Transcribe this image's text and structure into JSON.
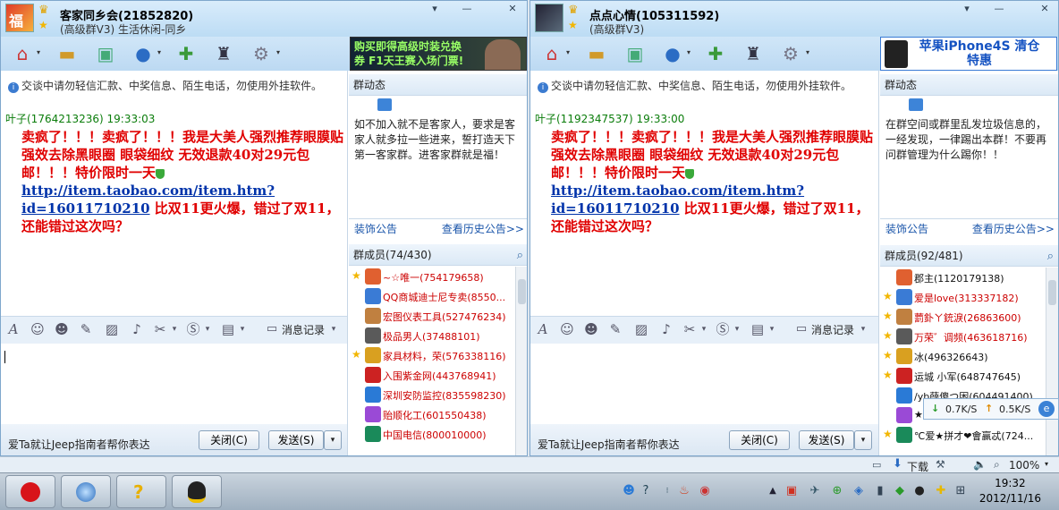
{
  "left_window": {
    "title": "客家同乡会(21852820)",
    "subtitle": "(高级群V3) 生活休闲-同乡",
    "ad_text": "购买即得高级时装兑换券 F1天王赛入场门票!",
    "notice": "交谈中请勿轻信汇款、中奖信息、陌生电话，勿使用外挂软件。",
    "message": {
      "sender": "叶子(1764213236)  19:33:03",
      "text": "卖疯了！！！卖疯了！！！我是大美人强烈推荐眼膜贴 强效去除黑眼圈 眼袋细纹 无效退款40对29元包邮！！！特价限时一天",
      "link": "http://item.taobao.com/item.htm?id=16011710210",
      "text_after": " 比双11更火爆，错过了双11，还能错过这次吗？"
    },
    "history_label": "消息记录",
    "bottom_tip": "爱Ta就让Jeep指南者帮你表达",
    "close_label": "关闭(C)",
    "send_label": "发送(S)",
    "bulletin_header": "群动态",
    "bulletin_text": "如不加入就不是客家人，要求是客家人就多拉一些进来，誓打造天下第一客家群。进客家群就是福！",
    "decorate_label": "装饰公告",
    "history_notice_label": "查看历史公告>>",
    "members_header": "群成员(74/430)",
    "members": [
      {
        "name": "~☆唯一(754179658)",
        "star": true
      },
      {
        "name": "QQ商城迪士尼专卖(8550...",
        "star": false
      },
      {
        "name": "宏图仪表工具(527476234)",
        "star": false
      },
      {
        "name": "极品男人(37488101)",
        "star": false
      },
      {
        "name": "家具材料，荣(576338116)",
        "star": true
      },
      {
        "name": "入围紫金网(443768941)",
        "star": false
      },
      {
        "name": "深圳安防监控(835598230)",
        "star": false
      },
      {
        "name": "贻顺化工(601550438)",
        "star": false
      },
      {
        "name": "中国电信(800010000)",
        "star": false
      }
    ]
  },
  "right_window": {
    "title": "点点心情(105311592)",
    "subtitle": "(高级群V3)",
    "ad_text": "苹果iPhone4S 清仓特惠",
    "notice": "交谈中请勿轻信汇款、中奖信息、陌生电话，勿使用外挂软件。",
    "message": {
      "sender": "叶子(1192347537)  19:33:00",
      "text": "卖疯了！！！卖疯了！！！我是大美人强烈推荐眼膜贴 强效去除黑眼圈 眼袋细纹 无效退款40对29元包邮！！！特价限时一天",
      "link": "http://item.taobao.com/item.htm?id=16011710210",
      "text_after": " 比双11更火爆，错过了双11，还能错过这次吗？"
    },
    "history_label": "消息记录",
    "bottom_tip": "爱Ta就让Jeep指南者帮你表达",
    "close_label": "关闭(C)",
    "send_label": "发送(S)",
    "bulletin_header": "群动态",
    "bulletin_text": "在群空间或群里乱发垃圾信息的，一经发现，一律踢出本群！不要再问群管理为什么踢你！！",
    "decorate_label": "装饰公告",
    "history_notice_label": "查看历史公告>>",
    "members_header": "群成员(92/481)",
    "members": [
      {
        "name": "郡主(1120179138)",
        "star": false,
        "black": true
      },
      {
        "name": "爱是love(313337182)",
        "star": true
      },
      {
        "name": "藅釙ㄚ銃淚(26863600)",
        "star": true
      },
      {
        "name": "万荣゛调频(463618716)",
        "star": true
      },
      {
        "name": "冰(496326643)",
        "star": true,
        "black": true
      },
      {
        "name": "运城 小军(648747645)",
        "star": true,
        "black": true
      },
      {
        "name": "/yb薛傻つ困(604491400)",
        "star": false,
        "black": true
      },
      {
        "name": "★",
        "star": false,
        "black": true
      },
      {
        "name": "℃爱★拼才❤會赢忒(724...",
        "star": true,
        "black": true
      }
    ],
    "speed_down": "0.7K/S",
    "speed_up": "0.5K/S"
  },
  "download_strip": {
    "download_label": "下载",
    "zoom": "100%"
  },
  "taskbar": {
    "time": "19:32",
    "date": "2012/11/16"
  }
}
